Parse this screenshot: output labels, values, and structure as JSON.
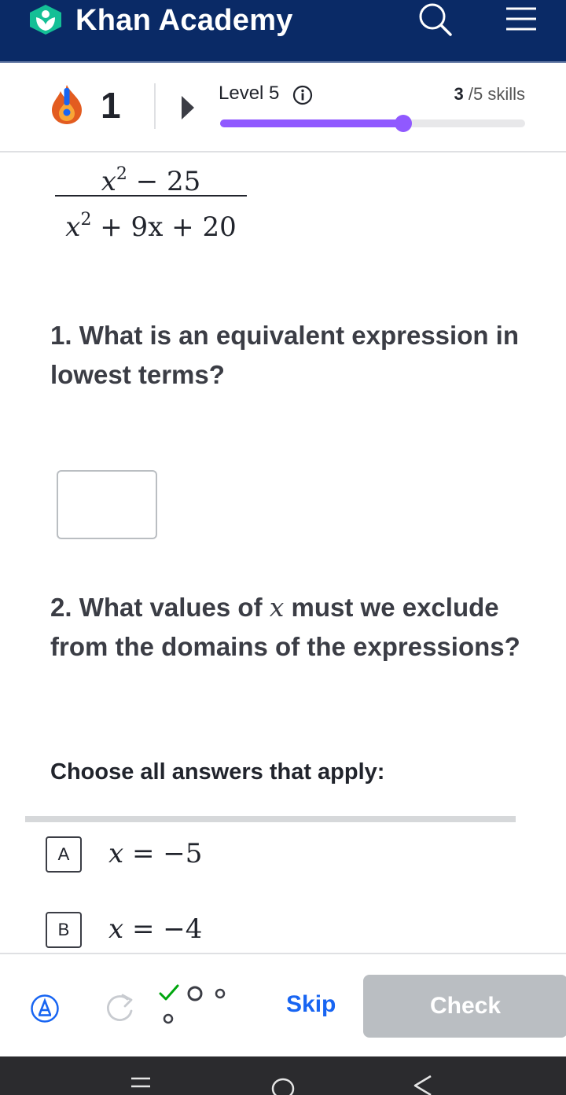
{
  "header": {
    "brand": "Khan Academy",
    "logo_icon": "khan-leaf-logo",
    "search_icon": "search-icon",
    "menu_icon": "hamburger-menu-icon",
    "bg_color": "#0a2a66",
    "logo_color": "#14bf96"
  },
  "progress": {
    "streak_count": "1",
    "level_label": "Level 5",
    "skills_done": "3",
    "skills_total": "/5 skills",
    "bar_fraction": 0.6,
    "bar_color": "#9059ff"
  },
  "problem": {
    "numerator": {
      "base": "x",
      "exp": "2",
      "rest": " − 25"
    },
    "denominator": {
      "base": "x",
      "exp": "2",
      "rest": " + 9x + 20"
    },
    "question_1": "1. What is an equivalent expression in lowest terms?",
    "question_2_pre": "2. What values of ",
    "question_2_var": "x",
    "question_2_post": " must we exclude from the domains of the expressions?",
    "choose_label": "Choose all answers that apply:",
    "choices": [
      {
        "letter": "A",
        "var": "x",
        "rest": " = −5"
      },
      {
        "letter": "B",
        "var": "x",
        "rest": " = −4"
      }
    ]
  },
  "footer": {
    "skip_label": "Skip",
    "check_label": "Check",
    "calc_icon": "calculator-icon",
    "retry_icon": "retry-icon",
    "attempts_icon": "attempt-dots-icon"
  },
  "system_nav": {
    "recents_icon": "recents-icon",
    "home_icon": "home-icon",
    "back_icon": "back-icon"
  }
}
